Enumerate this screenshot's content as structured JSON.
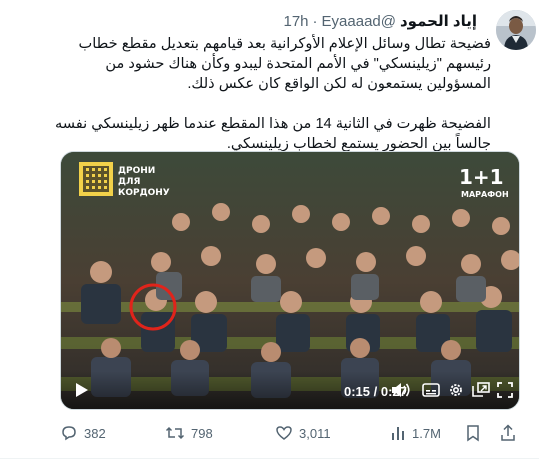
{
  "tweet": {
    "author_name": "إياد الحمود",
    "author_handle": "@Eyaaaad",
    "separator": "·",
    "time": "17h",
    "text_paragraphs": [
      "فضيحة تطال وسائل الإعلام الأوكرانية بعد قيامهم بتعديل مقطع خطاب رئيسهم \"زيلينسكي\" في الأمم المتحدة ليبدو وكأن هناك حشود من المسؤولين يستمعون له لكن الواقع كان عكس ذلك.",
      "الفضيحة ظهرت في الثانية 14 من هذا المقطع عندما ظهر زيلينسكي نفسه جالساً بين الحضور يستمع لخطاب زيلينسكي."
    ]
  },
  "video": {
    "overlay_text": "ДРОНИ\nДЛЯ\nКОРДОНУ",
    "channel_logo": "1+1",
    "channel_subtitle": "МАРАФОН",
    "time_display": "0:15 / 0:27",
    "highlight_color": "#e0241b",
    "icons": [
      "play-icon",
      "volume-icon",
      "captions-icon",
      "settings-gear-icon",
      "picture-in-picture-icon",
      "fullscreen-icon"
    ]
  },
  "actions": {
    "replies": "382",
    "reposts": "798",
    "likes": "3,011",
    "views": "1.7M"
  },
  "colors": {
    "text_primary": "#0f1419",
    "text_secondary": "#536471",
    "border": "#cfd9de"
  }
}
